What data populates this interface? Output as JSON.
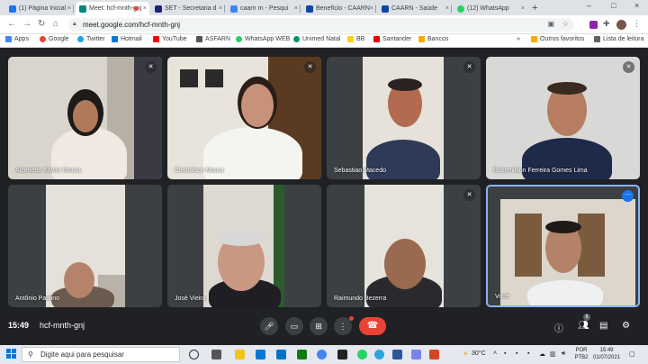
{
  "browser": {
    "tabs": [
      {
        "title": "(1) Página Inicial",
        "color": "#1877f2"
      },
      {
        "title": "Meet: hcf-mnth-gnj",
        "color": "#00897b"
      },
      {
        "title": "SET - Secretaria d",
        "color": "#1a237e"
      },
      {
        "title": "caarn rn - Pesqui",
        "color": "#4285f4"
      },
      {
        "title": "Benefício - CAARN",
        "color": "#0d47a1"
      },
      {
        "title": "CAARN - Saúde",
        "color": "#0d47a1"
      },
      {
        "title": "(12) WhatsApp",
        "color": "#25d366"
      }
    ],
    "tab_close": "×",
    "new_tab": "+",
    "window_controls": [
      "–",
      "□",
      "×"
    ],
    "url": "meet.google.com/hcf-mnth-gnj",
    "bookmarks": [
      {
        "label": "Apps",
        "color": "#4285f4"
      },
      {
        "label": "Google",
        "color": "#ea4335"
      },
      {
        "label": "Twitter",
        "color": "#1da1f2"
      },
      {
        "label": "Hotmail",
        "color": "#0078d4"
      },
      {
        "label": "YouTube",
        "color": "#ff0000"
      },
      {
        "label": "ASFARN",
        "color": "#555555"
      },
      {
        "label": "WhatsApp WEB",
        "color": "#25d366"
      },
      {
        "label": "Unimed Natal",
        "color": "#00995d"
      },
      {
        "label": "BB",
        "color": "#fcd116"
      },
      {
        "label": "Santander",
        "color": "#ec0000"
      },
      {
        "label": "Bancos",
        "color": "#f9ab00"
      }
    ],
    "bookmarks_overflow": "»",
    "other_bookmarks": "Outros favoritos",
    "reading_list": "Lista de leitura"
  },
  "meet": {
    "participants": [
      {
        "name": "Alzenette Xavier Moura",
        "muted": true
      },
      {
        "name": "Cleonilson Moura",
        "muted": true
      },
      {
        "name": "Sebastiao Macedo",
        "muted": true
      },
      {
        "name": "Rosemilson Ferreira Gomes Lima",
        "muted": true
      },
      {
        "name": "Antônio Paulino",
        "muted": false
      },
      {
        "name": "José Vieira",
        "muted": false
      },
      {
        "name": "Raimundo Bezerra",
        "muted": true
      },
      {
        "name": "Você",
        "muted": false
      }
    ],
    "time": "15:49",
    "meeting_code": "hcf-mnth-gnj",
    "participant_count": "8",
    "more_label": "⋯"
  },
  "taskbar": {
    "search_placeholder": "Digite aqui para pesquisar",
    "weather": "30°C",
    "lang_top": "POR",
    "lang_bottom": "PTB2",
    "clock_time": "15:49",
    "clock_date": "01/07/2021"
  }
}
